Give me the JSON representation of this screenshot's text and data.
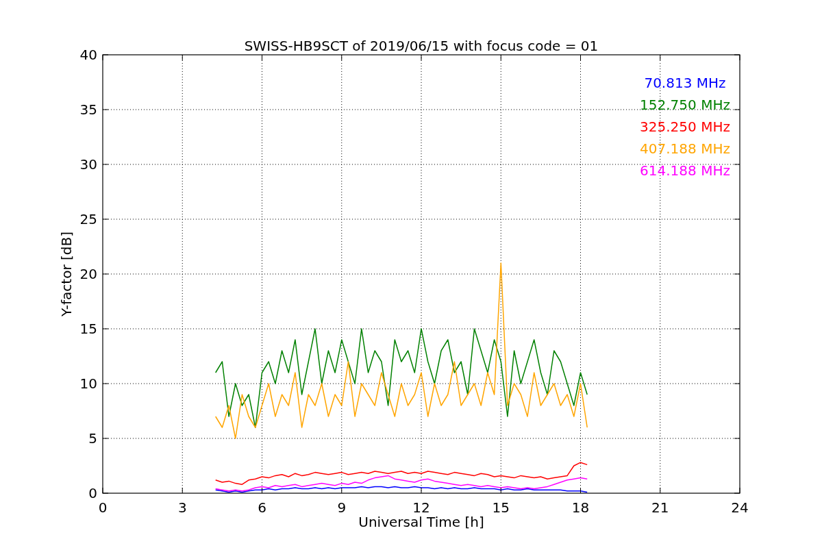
{
  "figure": {
    "chart_data": {
      "type": "line",
      "grid": true,
      "title": "SWISS-HB9SCT of 2019/06/15 with focus code = 01",
      "xlabel": "Universal Time [h]",
      "ylabel": "Y-factor [dB]",
      "xlim": [
        0,
        24
      ],
      "ylim": [
        0,
        40
      ],
      "xticks": [
        0,
        3,
        6,
        9,
        12,
        15,
        18,
        21,
        24
      ],
      "yticks": [
        0,
        5,
        10,
        15,
        20,
        25,
        30,
        35,
        40
      ],
      "x": [
        4.25,
        4.5,
        4.75,
        5,
        5.25,
        5.5,
        5.75,
        6,
        6.25,
        6.5,
        6.75,
        7,
        7.25,
        7.5,
        7.75,
        8,
        8.25,
        8.5,
        8.75,
        9,
        9.25,
        9.5,
        9.75,
        10,
        10.25,
        10.5,
        10.75,
        11,
        11.25,
        11.5,
        11.75,
        12,
        12.25,
        12.5,
        12.75,
        13,
        13.25,
        13.5,
        13.75,
        14,
        14.25,
        14.5,
        14.75,
        15,
        15.25,
        15.5,
        15.75,
        16,
        16.25,
        16.5,
        16.75,
        17,
        17.25,
        17.5,
        17.75,
        18,
        18.25
      ],
      "series": [
        {
          "name": "70.813 MHz",
          "color": "#0000ff",
          "values": [
            0.3,
            0.2,
            0.1,
            0.2,
            0.1,
            0.2,
            0.3,
            0.3,
            0.4,
            0.3,
            0.4,
            0.4,
            0.5,
            0.4,
            0.4,
            0.5,
            0.4,
            0.5,
            0.4,
            0.5,
            0.5,
            0.5,
            0.6,
            0.5,
            0.6,
            0.6,
            0.5,
            0.6,
            0.5,
            0.5,
            0.6,
            0.5,
            0.5,
            0.4,
            0.5,
            0.4,
            0.5,
            0.4,
            0.4,
            0.5,
            0.4,
            0.4,
            0.4,
            0.3,
            0.4,
            0.3,
            0.3,
            0.4,
            0.3,
            0.3,
            0.3,
            0.3,
            0.3,
            0.2,
            0.2,
            0.2,
            0.1
          ]
        },
        {
          "name": "152.750 MHz",
          "color": "#008000",
          "values": [
            11,
            12,
            7,
            10,
            8,
            9,
            6,
            11,
            12,
            10,
            13,
            11,
            14,
            9,
            12,
            15,
            10,
            13,
            11,
            14,
            12,
            10,
            15,
            11,
            13,
            12,
            8,
            14,
            12,
            13,
            11,
            15,
            12,
            10,
            13,
            14,
            11,
            12,
            9,
            15,
            13,
            11,
            14,
            12,
            7,
            13,
            10,
            12,
            14,
            11,
            9,
            13,
            12,
            10,
            8,
            11,
            9
          ]
        },
        {
          "name": "325.250 MHz",
          "color": "#ff0000",
          "values": [
            1.2,
            1.0,
            1.1,
            0.9,
            0.8,
            1.2,
            1.3,
            1.5,
            1.4,
            1.6,
            1.7,
            1.5,
            1.8,
            1.6,
            1.7,
            1.9,
            1.8,
            1.7,
            1.8,
            1.9,
            1.7,
            1.8,
            1.9,
            1.8,
            2.0,
            1.9,
            1.8,
            1.9,
            2.0,
            1.8,
            1.9,
            1.8,
            2.0,
            1.9,
            1.8,
            1.7,
            1.9,
            1.8,
            1.7,
            1.6,
            1.8,
            1.7,
            1.5,
            1.6,
            1.5,
            1.4,
            1.6,
            1.5,
            1.4,
            1.5,
            1.3,
            1.4,
            1.5,
            1.6,
            2.5,
            2.8,
            2.6
          ]
        },
        {
          "name": "407.188 MHz",
          "color": "#ffa500",
          "values": [
            7,
            6,
            8,
            5,
            9,
            7,
            6,
            8,
            10,
            7,
            9,
            8,
            11,
            6,
            9,
            8,
            10,
            7,
            9,
            8,
            12,
            7,
            10,
            9,
            8,
            11,
            9,
            7,
            10,
            8,
            9,
            11,
            7,
            10,
            8,
            9,
            12,
            8,
            9,
            10,
            8,
            11,
            9,
            21,
            8,
            10,
            9,
            7,
            11,
            8,
            9,
            10,
            8,
            9,
            7,
            10,
            6
          ]
        },
        {
          "name": "614.188 MHz",
          "color": "#ff00ff",
          "values": [
            0.4,
            0.3,
            0.2,
            0.3,
            0.2,
            0.3,
            0.5,
            0.6,
            0.5,
            0.7,
            0.6,
            0.7,
            0.8,
            0.6,
            0.7,
            0.8,
            0.9,
            0.8,
            0.7,
            0.9,
            0.8,
            1.0,
            0.9,
            1.2,
            1.4,
            1.5,
            1.6,
            1.3,
            1.2,
            1.1,
            1.0,
            1.2,
            1.3,
            1.1,
            1.0,
            0.9,
            0.8,
            0.7,
            0.8,
            0.7,
            0.6,
            0.7,
            0.6,
            0.5,
            0.6,
            0.5,
            0.4,
            0.5,
            0.4,
            0.5,
            0.6,
            0.8,
            1.0,
            1.2,
            1.3,
            1.4,
            1.3
          ]
        }
      ]
    }
  }
}
